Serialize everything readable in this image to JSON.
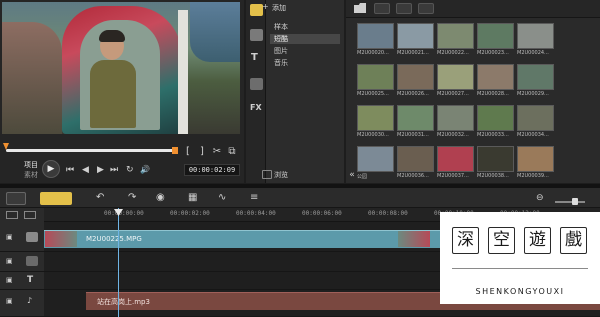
{
  "preview": {
    "mode_project": "项目",
    "mode_clip": "素材",
    "timecode": "00:00:02:09",
    "controls": {
      "mark_in": "[",
      "mark_out": "]",
      "cut": "✂",
      "enlarge": "⧉",
      "play": "▶",
      "home": "⏮",
      "prev_frame": "◀",
      "next_frame": "▶",
      "end": "⏭",
      "repeat": "↻",
      "volume": "🔊"
    }
  },
  "library": {
    "add_label": "添加",
    "browse_label": "浏览",
    "categories": [
      "样本",
      "短酷",
      "图片",
      "音乐"
    ],
    "thumbnails": [
      {
        "label": "M2U00020...",
        "color": "#6a7d8c"
      },
      {
        "label": "M2U00021...",
        "color": "#8a9aa4"
      },
      {
        "label": "M2U00022...",
        "color": "#7d8a70"
      },
      {
        "label": "M2U00023...",
        "color": "#5e7a62"
      },
      {
        "label": "M2U00024...",
        "color": "#8a8f8a"
      },
      {
        "label": "M2U00025...",
        "color": "#6e8058"
      },
      {
        "label": "M2U00026...",
        "color": "#7a6a5a"
      },
      {
        "label": "M2U00027...",
        "color": "#9aa07a"
      },
      {
        "label": "M2U00028...",
        "color": "#8c7a6a"
      },
      {
        "label": "M2U00029...",
        "color": "#607868"
      },
      {
        "label": "M2U00030...",
        "color": "#7e8c5e"
      },
      {
        "label": "M2U00031...",
        "color": "#6e8a6a"
      },
      {
        "label": "M2U00032...",
        "color": "#7a8474"
      },
      {
        "label": "M2U00033...",
        "color": "#5f7a4e"
      },
      {
        "label": "M2U00034...",
        "color": "#6c6f5e"
      },
      {
        "label": "公园",
        "color": "#7c8a96"
      },
      {
        "label": "M2U00036...",
        "color": "#6a5e50"
      },
      {
        "label": "M2U00037...",
        "color": "#b04050"
      },
      {
        "label": "M2U00038...",
        "color": "#3a3a30"
      },
      {
        "label": "M2U00039...",
        "color": "#9a7a5a"
      }
    ]
  },
  "timeline": {
    "ruler_labels": [
      "00:00:00:00",
      "00:00:02:00",
      "00:00:04:00",
      "00:00:06:00",
      "00:00:08:00",
      "00:00:10:00",
      "00:00:12:00"
    ],
    "video_clip_label": "M2U00225.MPG",
    "audio_clip_label": "站在高岗上.mp3"
  },
  "watermark": {
    "chars": [
      "深",
      "空",
      "遊",
      "戲"
    ],
    "text": "SHENKONGYOUXI"
  }
}
